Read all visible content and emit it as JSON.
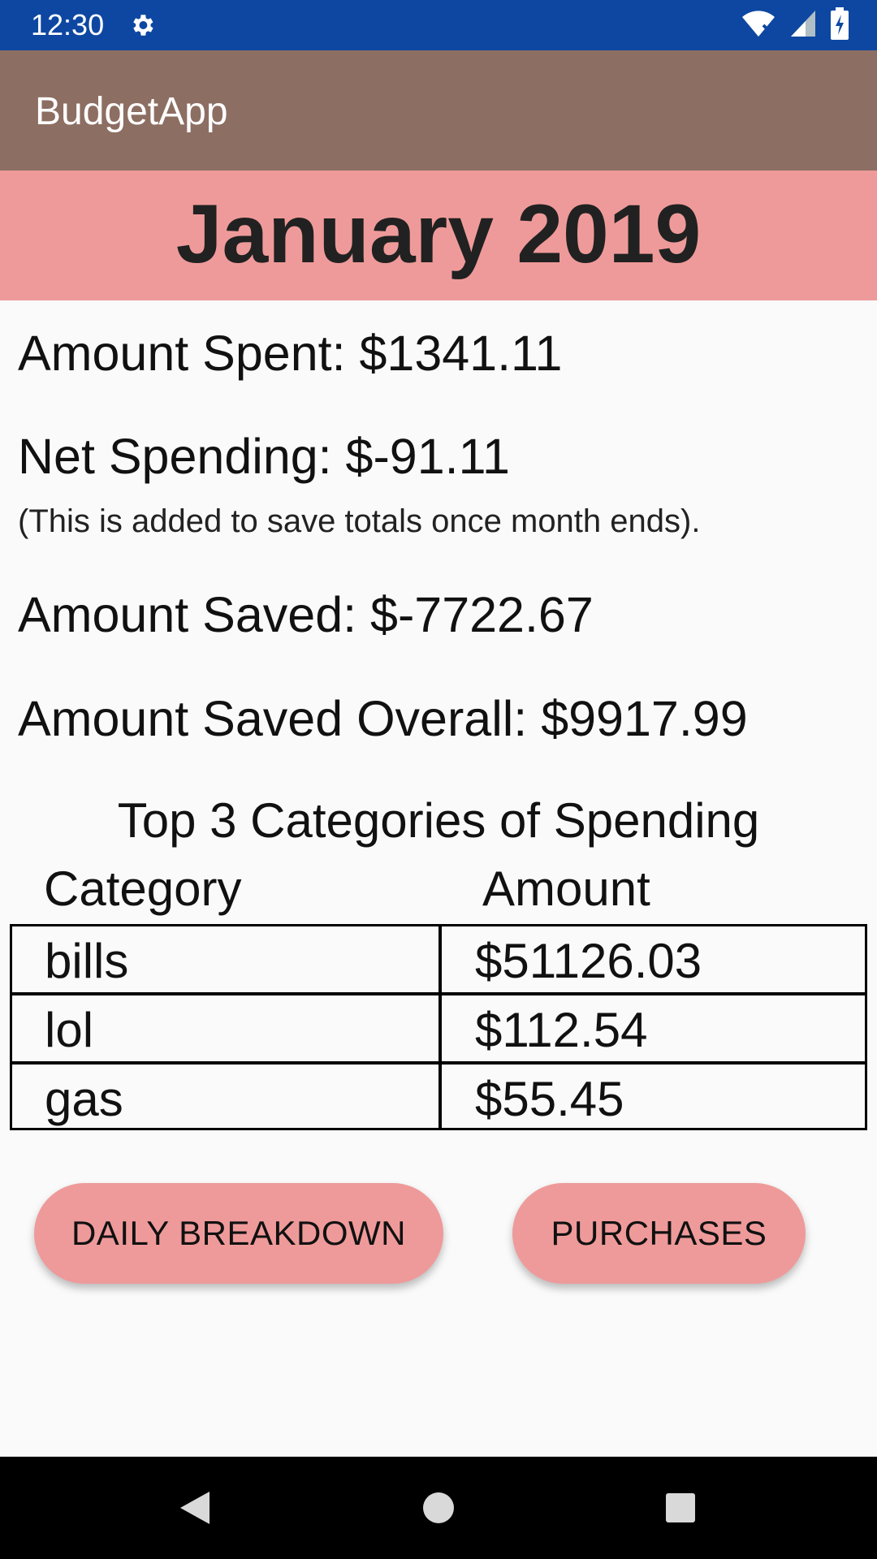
{
  "status_bar": {
    "time": "12:30",
    "icons": [
      "gear-icon",
      "wifi-icon",
      "signal-icon",
      "battery-icon"
    ]
  },
  "app_bar": {
    "title": "BudgetApp"
  },
  "month": {
    "title": "January 2019"
  },
  "stats": {
    "amount_spent": "Amount Spent: $1341.11",
    "net_spending": "Net Spending: $-91.11",
    "net_note": "(This is added to save totals once month ends).",
    "amount_saved": "Amount Saved: $-7722.67",
    "amount_saved_overall": "Amount Saved Overall: $9917.99"
  },
  "top_categories": {
    "title": "Top 3 Categories of Spending",
    "headers": {
      "category": "Category",
      "amount": "Amount"
    },
    "rows": [
      {
        "category": "bills",
        "amount": "$51126.03"
      },
      {
        "category": "lol",
        "amount": "$112.54"
      },
      {
        "category": "gas",
        "amount": "$55.45"
      }
    ]
  },
  "buttons": {
    "daily_breakdown": "DAILY BREAKDOWN",
    "purchases": "PURCHASES"
  },
  "colors": {
    "status_bar": "#0d47a1",
    "app_bar": "#8d6e63",
    "accent": "#ef9a9a",
    "background": "#fafafa"
  },
  "nav_bar": {
    "icons": [
      "back-icon",
      "home-icon",
      "recents-icon"
    ]
  }
}
